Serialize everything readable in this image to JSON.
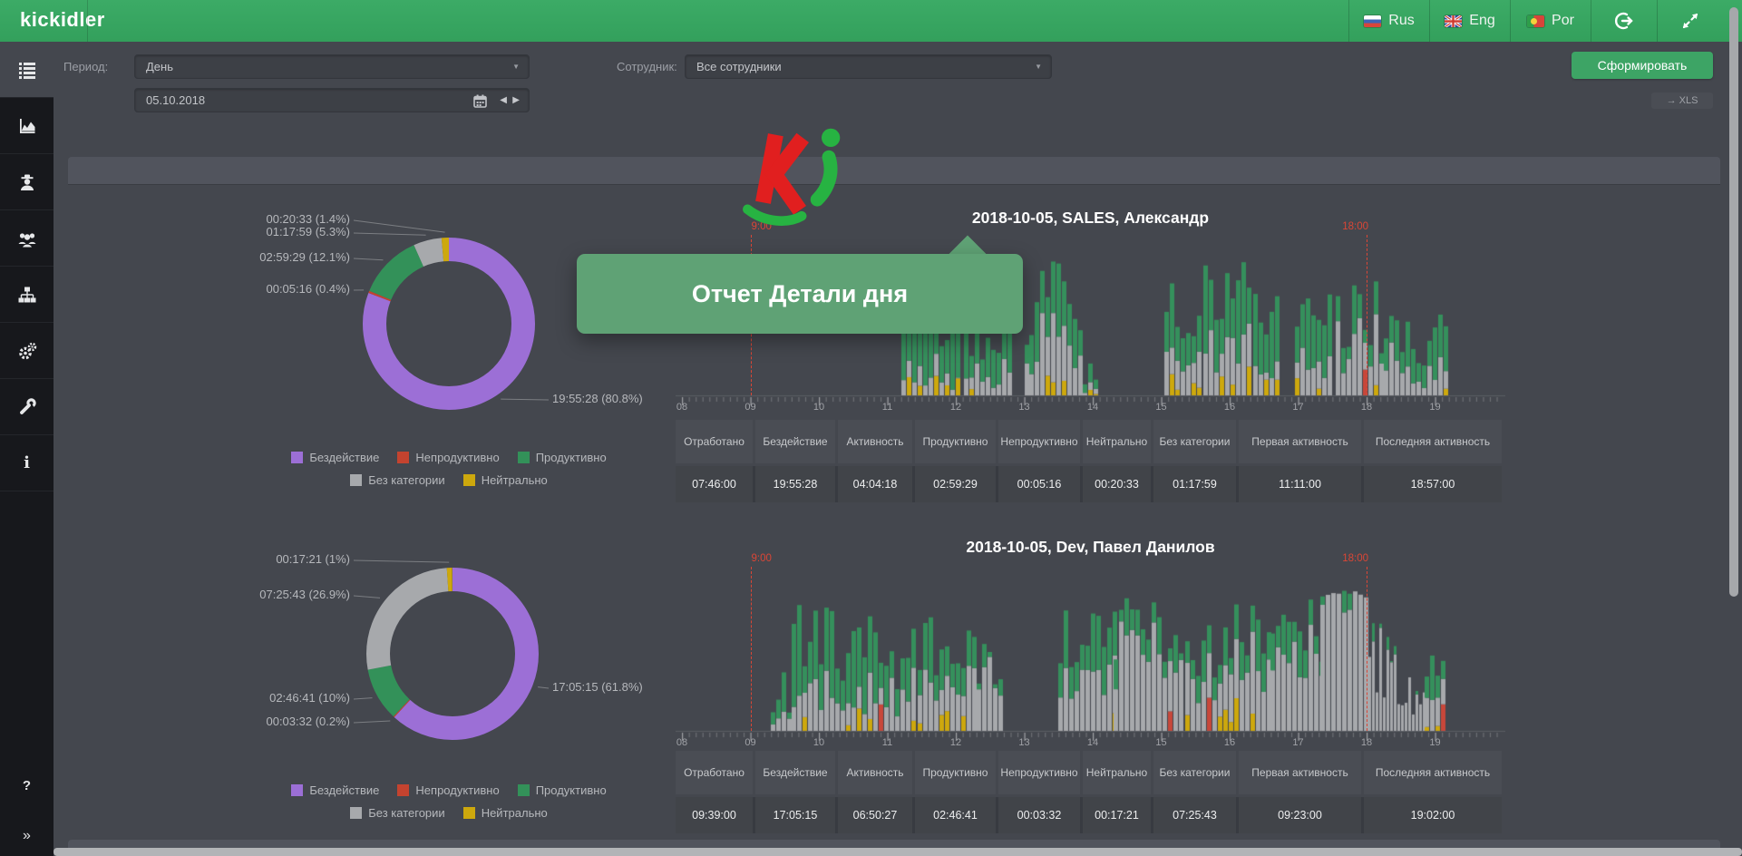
{
  "topbar": {
    "brand": "kickidler",
    "languages": [
      {
        "code": "rus",
        "label": "Rus"
      },
      {
        "code": "eng",
        "label": "Eng"
      },
      {
        "code": "por",
        "label": "Por"
      }
    ]
  },
  "sidebar": {
    "icons": [
      "report-list-icon",
      "chart-icon",
      "agent-icon",
      "group-icon",
      "structure-icon",
      "gears-icon",
      "wrench-icon",
      "info-icon"
    ],
    "help_label": "?",
    "collapse_label": "»"
  },
  "filters": {
    "period_label": "Период:",
    "period_value": "День",
    "date_value": "05.10.2018",
    "employee_label": "Сотрудник:",
    "employee_value": "Все сотрудники",
    "generate_button": "Сформировать",
    "export_button": "→ XLS"
  },
  "tooltip": {
    "text": "Отчет Детали дня"
  },
  "legend": [
    {
      "label": "Бездействие",
      "color": "#9c6fd6"
    },
    {
      "label": "Непродуктивно",
      "color": "#c4432f"
    },
    {
      "label": "Продуктивно",
      "color": "#339159"
    },
    {
      "label": "Без категории",
      "color": "#a7a9ac"
    },
    {
      "label": "Нейтрально",
      "color": "#cda80d"
    }
  ],
  "table_headers": [
    "Отработано",
    "Бездействие",
    "Активность",
    "Продуктивно",
    "Непродуктивно",
    "Нейтрально",
    "Без категории",
    "Первая активность",
    "Последняя активность"
  ],
  "chart_data": [
    {
      "type": "pie",
      "title": "2018-10-05, SALES, Александр",
      "slices": [
        {
          "label": "Бездействие",
          "time": "19:55:28",
          "pct": 80.8,
          "color": "#9c6fd6"
        },
        {
          "label": "Непродуктивно",
          "time": "00:05:16",
          "pct": 0.4,
          "color": "#c4432f"
        },
        {
          "label": "Продуктивно",
          "time": "02:59:29",
          "pct": 12.1,
          "color": "#339159"
        },
        {
          "label": "Без категории",
          "time": "01:17:59",
          "pct": 5.3,
          "color": "#a7a9ac"
        },
        {
          "label": "Нейтрально",
          "time": "00:20:33",
          "pct": 1.4,
          "color": "#cda80d"
        }
      ]
    },
    {
      "type": "bar",
      "subtype": "activity-timeline",
      "title": "2018-10-05, SALES, Александр",
      "x_ticks": [
        "08",
        "09",
        "10",
        "11",
        "12",
        "13",
        "14",
        "15",
        "16",
        "17",
        "18",
        "19"
      ],
      "work_start": "9:00",
      "work_end": "18:00",
      "seed": 11,
      "active_periods": [
        {
          "from": 11.2,
          "to": 12.07,
          "hmin": 50,
          "hmax": 125,
          "grey": 0.18,
          "yellow": 0.35,
          "red": 0.02
        },
        {
          "from": 12.12,
          "to": 12.8,
          "hmin": 35,
          "hmax": 130,
          "grey": 0.3,
          "yellow": 0.25,
          "red": 0.05
        },
        {
          "from": 13.0,
          "to": 13.8,
          "hmin": 55,
          "hmax": 148,
          "grey": 0.5,
          "yellow": 0.22,
          "red": 0.03
        },
        {
          "from": 13.85,
          "to": 14.05,
          "hmin": 12,
          "hmax": 45,
          "grey": 0.25,
          "yellow": 0.5,
          "red": 0
        },
        {
          "from": 15.05,
          "to": 15.6,
          "hmin": 40,
          "hmax": 125,
          "grey": 0.45,
          "yellow": 0.25,
          "red": 0.12
        },
        {
          "from": 15.62,
          "to": 16.3,
          "hmin": 75,
          "hmax": 158,
          "grey": 0.45,
          "yellow": 0.45,
          "red": 0.02
        },
        {
          "from": 16.35,
          "to": 16.7,
          "hmin": 55,
          "hmax": 120,
          "grey": 0.3,
          "yellow": 0.3,
          "red": 0
        },
        {
          "from": 16.95,
          "to": 17.5,
          "hmin": 65,
          "hmax": 142,
          "grey": 0.35,
          "yellow": 0.25,
          "red": 0.04
        },
        {
          "from": 17.55,
          "to": 18.2,
          "hmin": 45,
          "hmax": 130,
          "grey": 0.6,
          "yellow": 0.2,
          "red": 0.07
        },
        {
          "from": 18.25,
          "to": 18.6,
          "hmin": 40,
          "hmax": 118,
          "grey": 0.5,
          "yellow": 0.2,
          "red": 0.1
        },
        {
          "from": 18.65,
          "to": 19.15,
          "hmin": 28,
          "hmax": 105,
          "grey": 0.4,
          "yellow": 0.25,
          "red": 0
        }
      ]
    },
    {
      "type": "table",
      "row": [
        "07:46:00",
        "19:55:28",
        "04:04:18",
        "02:59:29",
        "00:05:16",
        "00:20:33",
        "01:17:59",
        "11:11:00",
        "18:57:00"
      ]
    },
    {
      "type": "pie",
      "title": "2018-10-05, Dev, Павел Данилов",
      "slices": [
        {
          "label": "Бездействие",
          "time": "17:05:15",
          "pct": 61.8,
          "color": "#9c6fd6"
        },
        {
          "label": "Непродуктивно",
          "time": "00:03:32",
          "pct": 0.2,
          "color": "#c4432f"
        },
        {
          "label": "Продуктивно",
          "time": "02:46:41",
          "pct": 10,
          "color": "#339159"
        },
        {
          "label": "Без категории",
          "time": "07:25:43",
          "pct": 26.9,
          "color": "#a7a9ac"
        },
        {
          "label": "Нейтрально",
          "time": "00:17:21",
          "pct": 1,
          "color": "#cda80d"
        }
      ]
    },
    {
      "type": "bar",
      "subtype": "activity-timeline",
      "title": "2018-10-05, Dev, Павел Данилов",
      "x_ticks": [
        "08",
        "09",
        "10",
        "11",
        "12",
        "13",
        "14",
        "15",
        "16",
        "17",
        "18",
        "19"
      ],
      "work_start": "9:00",
      "work_end": "18:00",
      "seed": 23,
      "active_periods": [
        {
          "from": 9.3,
          "to": 9.6,
          "hmin": 15,
          "hmax": 75,
          "grey": 0.5,
          "yellow": 0.4,
          "red": 0
        },
        {
          "from": 9.6,
          "to": 10.9,
          "hmin": 55,
          "hmax": 140,
          "grey": 0.38,
          "yellow": 0.25,
          "red": 0.03
        },
        {
          "from": 10.95,
          "to": 11.4,
          "hmin": 30,
          "hmax": 115,
          "grey": 0.5,
          "yellow": 0.2,
          "red": 0.04
        },
        {
          "from": 11.45,
          "to": 12.3,
          "hmin": 55,
          "hmax": 132,
          "grey": 0.55,
          "yellow": 0.22,
          "red": 0
        },
        {
          "from": 12.3,
          "to": 12.68,
          "hmin": 45,
          "hmax": 108,
          "grey": 0.8,
          "yellow": 0.12,
          "red": 0
        },
        {
          "from": 13.5,
          "to": 14.3,
          "hmin": 65,
          "hmax": 140,
          "grey": 0.6,
          "yellow": 0.1,
          "red": 0
        },
        {
          "from": 14.3,
          "to": 15.3,
          "hmin": 75,
          "hmax": 150,
          "grey": 0.75,
          "yellow": 0.12,
          "red": 0.02
        },
        {
          "from": 15.35,
          "to": 16.6,
          "hmin": 55,
          "hmax": 140,
          "grey": 0.6,
          "yellow": 0.25,
          "red": 0.04
        },
        {
          "from": 16.6,
          "to": 17.32,
          "hmin": 75,
          "hmax": 150,
          "grey": 0.7,
          "yellow": 0.15,
          "red": 0
        },
        {
          "from": 17.32,
          "to": 18.02,
          "hmin": 145,
          "hmax": 155,
          "grey": 0.98,
          "yellow": 0,
          "red": 0
        },
        {
          "from": 18.02,
          "to": 18.85,
          "hmin": 40,
          "hmax": 140,
          "grey": 1,
          "yellow": 0.05,
          "red": 0,
          "fade": true,
          "striped": true
        },
        {
          "from": 18.85,
          "to": 19.15,
          "hmin": 35,
          "hmax": 105,
          "grey": 0.55,
          "yellow": 0.3,
          "red": 0.3
        }
      ]
    },
    {
      "type": "table",
      "row": [
        "09:39:00",
        "17:05:15",
        "06:50:27",
        "02:46:41",
        "00:03:32",
        "00:17:21",
        "07:25:43",
        "09:23:00",
        "19:02:00"
      ]
    }
  ]
}
